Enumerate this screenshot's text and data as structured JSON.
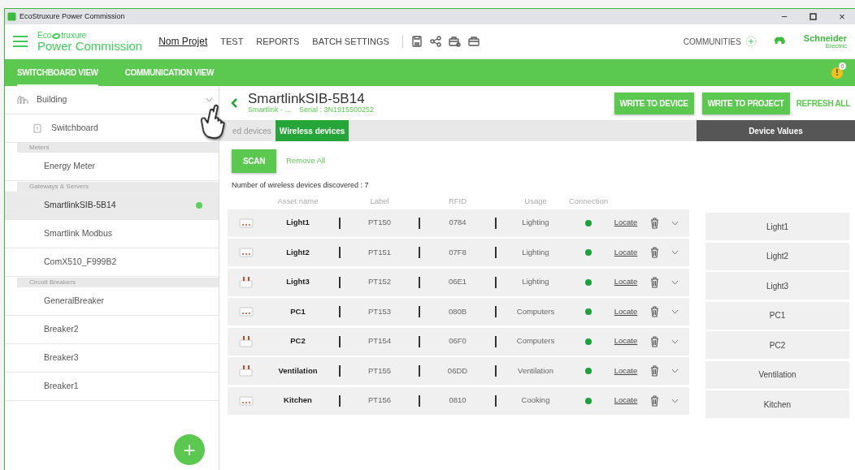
{
  "window": {
    "title": "EcoStruxure Power Commission",
    "minimize": "−",
    "close": "×"
  },
  "brand": {
    "top_left": "Eco",
    "top_right": "truxure",
    "name": "Power Commission"
  },
  "nav": [
    {
      "label": "Nom Projet",
      "selected": true
    },
    {
      "label": "TEST",
      "selected": false
    },
    {
      "label": "REPORTS",
      "selected": false
    },
    {
      "label": "BATCH SETTINGS",
      "selected": false
    }
  ],
  "communities": "COMMUNITIES",
  "vendor": {
    "name": "Schneider",
    "sub": "Electric"
  },
  "views": [
    {
      "label": "SWITCHBOARD VIEW",
      "selected": true
    },
    {
      "label": "COMMUNICATION VIEW",
      "selected": false
    }
  ],
  "alert": {
    "symbol": "!",
    "count": "0"
  },
  "sidebar": {
    "building": "Building",
    "switchboard": "Switchboard",
    "groups": [
      {
        "header": "Meters",
        "items": [
          {
            "label": "Energy Meter",
            "selected": false,
            "connected": false
          }
        ]
      },
      {
        "header": "Gateways & Servers",
        "items": [
          {
            "label": "SmartlinkSIB-5B14",
            "selected": true,
            "connected": true
          },
          {
            "label": "Smartlink Modbus",
            "selected": false,
            "connected": false
          },
          {
            "label": "ComX510_F999B2",
            "selected": false,
            "connected": false
          }
        ]
      },
      {
        "header": "Circuit Breakers",
        "items": [
          {
            "label": "GeneralBreaker",
            "selected": false,
            "connected": false
          },
          {
            "label": "Breaker2",
            "selected": false,
            "connected": false
          },
          {
            "label": "Breaker3",
            "selected": false,
            "connected": false
          },
          {
            "label": "Breaker1",
            "selected": false,
            "connected": false
          }
        ]
      }
    ],
    "add": "+"
  },
  "device": {
    "title": "SmartlinkSIB-5B14",
    "subtitle": "Smartlink - ...",
    "serial": "Serial : 3N1915500252"
  },
  "actions": [
    "WRITE TO DEVICE",
    "WRITE TO PROJECT"
  ],
  "refresh": "REFRESH ALL",
  "tabs": [
    {
      "label": "ed devices",
      "selected": false
    },
    {
      "label": "Wireless devices",
      "selected": true
    }
  ],
  "values_header": "Device Values",
  "scan": "SCAN",
  "remove_all": "Remove All",
  "count": "Number of wireless devices discovered : 7",
  "columns": [
    "Asset name",
    "Label",
    "RFID",
    "Usage",
    "Connection"
  ],
  "rows": [
    {
      "kind": "dots",
      "asset": "Light1",
      "label": "PT150",
      "rfid": "0784",
      "usage": "Lighting",
      "connected": true,
      "locate": "Locate",
      "value": "Light1"
    },
    {
      "kind": "dots",
      "asset": "Light2",
      "label": "PT151",
      "rfid": "07F8",
      "usage": "Lighting",
      "connected": true,
      "locate": "Locate",
      "value": "Light2"
    },
    {
      "kind": "prongs",
      "asset": "Light3",
      "label": "PT152",
      "rfid": "06E1",
      "usage": "Lighting",
      "connected": true,
      "locate": "Locate",
      "value": "Light3"
    },
    {
      "kind": "dots",
      "asset": "PC1",
      "label": "PT153",
      "rfid": "080B",
      "usage": "Computers",
      "connected": true,
      "locate": "Locate",
      "value": "PC1"
    },
    {
      "kind": "prongs",
      "asset": "PC2",
      "label": "PT154",
      "rfid": "06F0",
      "usage": "Computers",
      "connected": true,
      "locate": "Locate",
      "value": "PC2"
    },
    {
      "kind": "prongs",
      "asset": "Ventilation",
      "label": "PT155",
      "rfid": "06DD",
      "usage": "Ventilation",
      "connected": true,
      "locate": "Locate",
      "value": "Ventilation"
    },
    {
      "kind": "dots",
      "asset": "Kitchen",
      "label": "PT156",
      "rfid": "0810",
      "usage": "Cooking",
      "connected": true,
      "locate": "Locate",
      "value": "Kitchen"
    }
  ]
}
